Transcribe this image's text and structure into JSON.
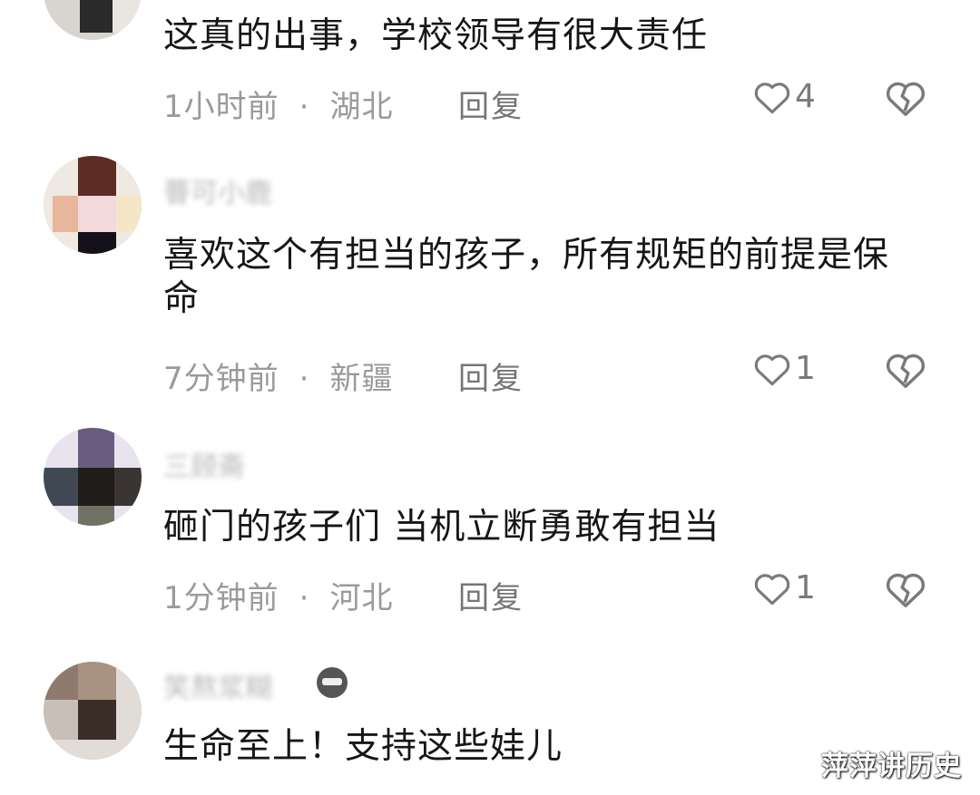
{
  "comments": [
    {
      "text": "这真的出事，学校领导有很大责任",
      "time": "1小时前",
      "location": "湖北",
      "reply_label": "回复",
      "likes": "4"
    },
    {
      "username": "瞢可小鹿",
      "text": "喜欢这个有担当的孩子，所有规矩的前提是保命",
      "time": "7分钟前",
      "location": "新疆",
      "reply_label": "回复",
      "likes": "1"
    },
    {
      "username": "三顾斋",
      "text": "砸门的孩子们  当机立断勇敢有担当",
      "time": "1分钟前",
      "location": "河北",
      "reply_label": "回复",
      "likes": "1"
    },
    {
      "username": "笑熬浆糊",
      "text": "生命至上！支持这些娃儿"
    }
  ],
  "meta_separator": "·",
  "watermark": "萍萍讲历史",
  "icons": {
    "like": "heart-outline-icon",
    "dislike": "broken-heart-icon"
  },
  "colors": {
    "text": "#161616",
    "meta": "#9a9a9a",
    "icon": "#7a7a7a"
  }
}
